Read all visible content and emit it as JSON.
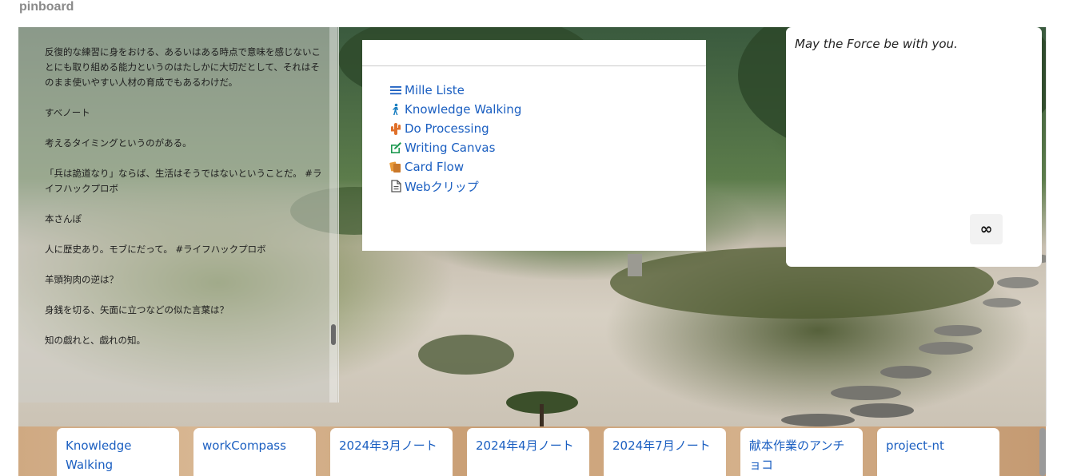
{
  "app": {
    "title": "pinboard"
  },
  "note": {
    "text": "なるのではないか？\n\n反復的な練習に身をおける、あるいはある時点で意味を感じないことにも取り組める能力というのはたしかに大切だとして、それはそのまま使いやすい人材の育成でもあるわけだ。\n\nすべノート\n\n考えるタイミングというのがある。\n\n「兵は詭道なり」ならば、生活はそうではないということだ。 #ライフハックプロボ\n\n本さんぽ\n\n人に歴史あり。モブにだって。 #ライフハックプロボ\n\n羊頭狗肉の逆は？\n\n身銭を切る、矢面に立つなどの似た言葉は？\n\n知の戯れと、戯れの知。"
  },
  "links": [
    {
      "label": "Mille Liste",
      "icon": "list-icon",
      "icon_color": "#1b5fc1"
    },
    {
      "label": "Knowledge Walking",
      "icon": "walking-person-icon",
      "icon_color": "#1b7fc1"
    },
    {
      "label": "Do Processing",
      "icon": "cactus-icon",
      "icon_color": "#e0702a"
    },
    {
      "label": "Writing Canvas",
      "icon": "edit-icon",
      "icon_color": "#1f9a52"
    },
    {
      "label": "Card Flow",
      "icon": "cards-icon",
      "icon_color": "#d0862a"
    },
    {
      "label": "Webクリップ",
      "icon": "document-icon",
      "icon_color": "#555555"
    }
  ],
  "quote": {
    "text": "May the Force be with you.",
    "button_label": "∞"
  },
  "tabs": [
    "Knowledge Walking",
    "workCompass",
    "2024年3月ノート",
    "2024年4月ノート",
    "2024年7月ノート",
    "献本作業のアンチョコ",
    "project-nt"
  ],
  "colors": {
    "link": "#1b5fc1",
    "title": "#8a8a8a"
  }
}
